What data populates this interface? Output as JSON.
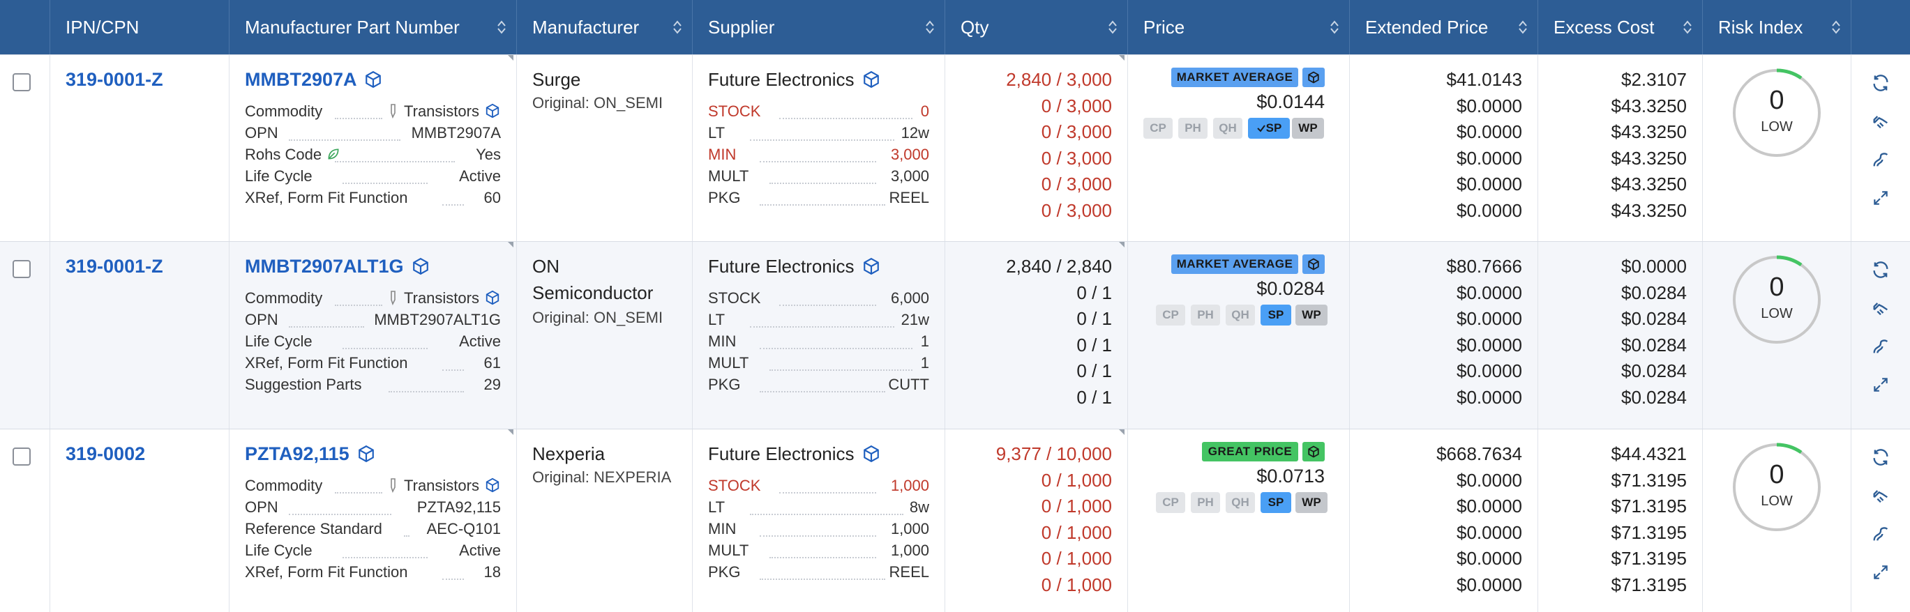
{
  "headers": {
    "ipn": "IPN/CPN",
    "mpn": "Manufacturer Part Number",
    "manufacturer": "Manufacturer",
    "supplier": "Supplier",
    "qty": "Qty",
    "price": "Price",
    "extended": "Extended Price",
    "excess": "Excess Cost",
    "risk": "Risk Index"
  },
  "rows": [
    {
      "ipn": "319-0001-Z",
      "mpn": "MMBT2907A",
      "attrs": [
        {
          "label": "Commodity",
          "value": "Transistors"
        },
        {
          "label": "OPN",
          "value": "MMBT2907A"
        },
        {
          "label": "Rohs Code",
          "value": "Yes"
        },
        {
          "label": "Life Cycle",
          "value": "Active"
        },
        {
          "label": "XRef, Form Fit Function",
          "value": "60"
        }
      ],
      "manufacturer": "Surge",
      "original": "Original: ON_SEMI",
      "supplier": "Future Electronics",
      "sattrs": [
        {
          "label": "STOCK",
          "value": "0"
        },
        {
          "label": "LT",
          "value": "12w"
        },
        {
          "label": "MIN",
          "value": "3,000"
        },
        {
          "label": "MULT",
          "value": "3,000"
        },
        {
          "label": "PKG",
          "value": "REEL"
        }
      ],
      "qty": [
        "2,840 / 3,000",
        "0 / 3,000",
        "0 / 3,000",
        "0 / 3,000",
        "0 / 3,000",
        "0 / 3,000"
      ],
      "badge": "MARKET AVERAGE",
      "unit_price": "$0.0144",
      "chips": [
        "CP",
        "PH",
        "QH",
        "SP",
        "WP"
      ],
      "extended": [
        "$41.0143",
        "$0.0000",
        "$0.0000",
        "$0.0000",
        "$0.0000",
        "$0.0000"
      ],
      "excess": [
        "$2.3107",
        "$43.3250",
        "$43.3250",
        "$43.3250",
        "$43.3250",
        "$43.3250"
      ],
      "risk_value": "0",
      "risk_label": "LOW"
    },
    {
      "ipn": "319-0001-Z",
      "mpn": "MMBT2907ALT1G",
      "attrs": [
        {
          "label": "Commodity",
          "value": "Transistors"
        },
        {
          "label": "OPN",
          "value": "MMBT2907ALT1G"
        },
        {
          "label": "Life Cycle",
          "value": "Active"
        },
        {
          "label": "XRef, Form Fit Function",
          "value": "61"
        },
        {
          "label": "Suggestion Parts",
          "value": "29"
        }
      ],
      "manufacturer_line1": "ON",
      "manufacturer_line2": "Semiconductor",
      "original": "Original: ON_SEMI",
      "supplier": "Future Electronics",
      "sattrs": [
        {
          "label": "STOCK",
          "value": "6,000"
        },
        {
          "label": "LT",
          "value": "21w"
        },
        {
          "label": "MIN",
          "value": "1"
        },
        {
          "label": "MULT",
          "value": "1"
        },
        {
          "label": "PKG",
          "value": "CUTT"
        }
      ],
      "qty": [
        "2,840 / 2,840",
        "0 / 1",
        "0 / 1",
        "0 / 1",
        "0 / 1",
        "0 / 1"
      ],
      "badge": "MARKET AVERAGE",
      "unit_price": "$0.0284",
      "chips": [
        "CP",
        "PH",
        "QH",
        "SP",
        "WP"
      ],
      "extended": [
        "$80.7666",
        "$0.0000",
        "$0.0000",
        "$0.0000",
        "$0.0000",
        "$0.0000"
      ],
      "excess": [
        "$0.0000",
        "$0.0284",
        "$0.0284",
        "$0.0284",
        "$0.0284",
        "$0.0284"
      ],
      "risk_value": "0",
      "risk_label": "LOW"
    },
    {
      "ipn": "319-0002",
      "mpn": "PZTA92,115",
      "attrs": [
        {
          "label": "Commodity",
          "value": "Transistors"
        },
        {
          "label": "OPN",
          "value": "PZTA92,115"
        },
        {
          "label": "Reference Standard",
          "value": "AEC-Q101"
        },
        {
          "label": "Life Cycle",
          "value": "Active"
        },
        {
          "label": "XRef, Form Fit Function",
          "value": "18"
        }
      ],
      "manufacturer": "Nexperia",
      "original": "Original: NEXPERIA",
      "supplier": "Future Electronics",
      "sattrs": [
        {
          "label": "STOCK",
          "value": "1,000"
        },
        {
          "label": "LT",
          "value": "8w"
        },
        {
          "label": "MIN",
          "value": "1,000"
        },
        {
          "label": "MULT",
          "value": "1,000"
        },
        {
          "label": "PKG",
          "value": "REEL"
        }
      ],
      "qty": [
        "9,377 / 10,000",
        "0 / 1,000",
        "0 / 1,000",
        "0 / 1,000",
        "0 / 1,000",
        "0 / 1,000"
      ],
      "badge": "GREAT PRICE",
      "unit_price": "$0.0713",
      "chips": [
        "CP",
        "PH",
        "QH",
        "SP",
        "WP"
      ],
      "extended": [
        "$668.7634",
        "$0.0000",
        "$0.0000",
        "$0.0000",
        "$0.0000",
        "$0.0000"
      ],
      "excess": [
        "$44.4321",
        "$71.3195",
        "$71.3195",
        "$71.3195",
        "$71.3195",
        "$71.3195"
      ],
      "risk_value": "0",
      "risk_label": "LOW"
    }
  ],
  "colors": {
    "header_bg": "#2d5d95",
    "link": "#1f5fbf",
    "warning_red": "#c0392b",
    "market_badge": "#5aa0f0",
    "great_badge": "#44c463",
    "risk_ring": "#c8c8c8",
    "risk_low": "#44c463"
  },
  "icons": [
    "cube-icon",
    "tag-icon",
    "leaf-icon",
    "sort-icon",
    "refresh-icon",
    "handshake-icon",
    "route-icon",
    "expand-icon",
    "check-icon"
  ]
}
